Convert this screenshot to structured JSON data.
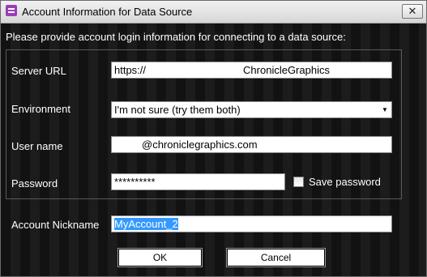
{
  "window": {
    "title": "Account Information for Data Source",
    "close_glyph": "✕"
  },
  "instruction": "Please provide account login information for connecting to a data source:",
  "form": {
    "server_url": {
      "label": "Server URL",
      "value_prefix": "https://",
      "value_suffix": "ChronicleGraphics"
    },
    "environment": {
      "label": "Environment",
      "selected": "I'm not sure (try them both)"
    },
    "user_name": {
      "label": "User name",
      "value": "@chroniclegraphics.com"
    },
    "password": {
      "label": "Password",
      "value": "**********",
      "save_label": "Save password",
      "save_checked": false
    },
    "account_nickname": {
      "label": "Account Nickname",
      "value": "MyAccount_2"
    }
  },
  "buttons": {
    "ok": "OK",
    "cancel": "Cancel"
  }
}
